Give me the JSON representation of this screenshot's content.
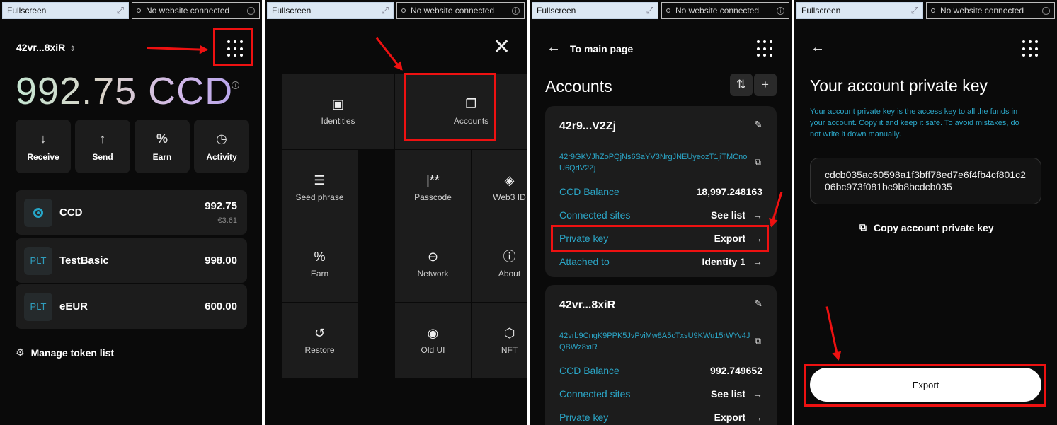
{
  "topbar": {
    "fullscreen_label": "Fullscreen",
    "connection_status": "No website connected",
    "expand_glyph": "⤢",
    "info_glyph": "i"
  },
  "home": {
    "account_name": "42vr...8xiR",
    "balance": "992.75 CCD",
    "actions": [
      {
        "label": "Receive",
        "icon": "↓"
      },
      {
        "label": "Send",
        "icon": "↑"
      },
      {
        "label": "Earn",
        "icon": "%"
      },
      {
        "label": "Activity",
        "icon": "◷"
      }
    ],
    "tokens": [
      {
        "name": "CCD",
        "amount": "992.75",
        "fiat": "€3.61",
        "logo": ""
      },
      {
        "name": "TestBasic",
        "amount": "998.00",
        "fiat": "",
        "logo": "PLT"
      },
      {
        "name": "eEUR",
        "amount": "600.00",
        "fiat": "",
        "logo": "PLT"
      }
    ],
    "manage_label": "Manage token list",
    "manage_icon": "⚙"
  },
  "menu": {
    "close_glyph": "✕",
    "items": [
      {
        "label": "Identities",
        "icon": "▣"
      },
      {
        "label": "Accounts",
        "icon": "❐"
      },
      {
        "label": "Seed phrase",
        "icon": "☰"
      },
      {
        "label": "Passcode",
        "icon": "|**"
      },
      {
        "label": "Web3 ID",
        "icon": "◈"
      },
      {
        "label": "Earn",
        "icon": "%"
      },
      {
        "label": "Network",
        "icon": "⊖"
      },
      {
        "label": "About",
        "icon": "ⓘ"
      },
      {
        "label": "Restore",
        "icon": "↺"
      },
      {
        "label": "Old UI",
        "icon": "◉"
      },
      {
        "label": "NFT",
        "icon": "⬡"
      }
    ]
  },
  "accounts": {
    "back_glyph": "←",
    "back_label": "To main page",
    "title": "Accounts",
    "sort_glyph": "⇅",
    "add_glyph": "+",
    "edit_glyph": "✎",
    "copy_glyph": "⧉",
    "arrow_glyph": "→",
    "list": [
      {
        "name": "42r9...V2Zj",
        "address": "42r9GKVJhZoPQjNs6SaYV3NrgJNEUyeozT1jiTMCnoU6QdV2Zj",
        "rows": [
          {
            "k": "CCD Balance",
            "v": "18,997.248163",
            "arrow": ""
          },
          {
            "k": "Connected sites",
            "v": "See list",
            "arrow": "→"
          },
          {
            "k": "Private key",
            "v": "Export",
            "arrow": "→"
          },
          {
            "k": "Attached to",
            "v": "Identity 1",
            "arrow": "→"
          }
        ]
      },
      {
        "name": "42vr...8xiR",
        "address": "42vrb9CngK9PPK5JvPviMw8A5cTxsU9KWu15rWYv4JQBWz8xiR",
        "rows": [
          {
            "k": "CCD Balance",
            "v": "992.749652",
            "arrow": ""
          },
          {
            "k": "Connected sites",
            "v": "See list",
            "arrow": "→"
          },
          {
            "k": "Private key",
            "v": "Export",
            "arrow": "→"
          }
        ]
      }
    ]
  },
  "private_key": {
    "back_glyph": "←",
    "title": "Your account private key",
    "description": "Your account private key is the access key to all the funds in your account. Copy it and keep it safe. To avoid mistakes, do not write it down manually.",
    "key": "cdcb035ac60598a1f3bff78ed7e6f4fb4cf801c206bc973f081bc9b8bcdcb035",
    "copy_label": "Copy account private key",
    "copy_glyph": "⧉",
    "export_label": "Export"
  },
  "colors": {
    "background": "#0a0a0a",
    "card": "#1c1c1c",
    "accent": "#2ba6c7",
    "annotation_red": "#ee1111"
  }
}
